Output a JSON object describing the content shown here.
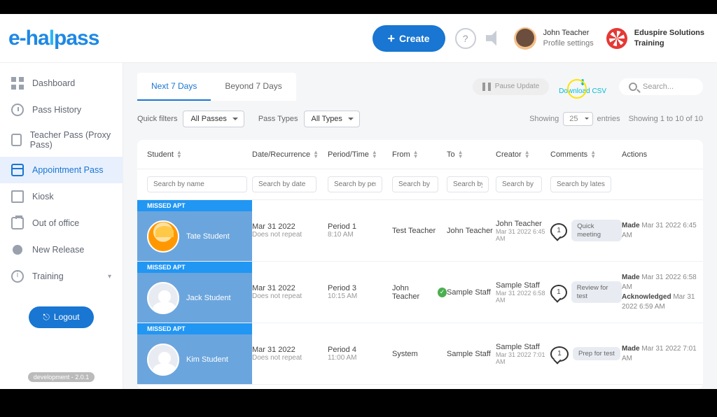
{
  "brand": {
    "name": "e-hallpass"
  },
  "topbar": {
    "create": "Create",
    "user_name": "John Teacher",
    "user_sub": "Profile settings",
    "org1": "Eduspire Solutions",
    "org2": "Training"
  },
  "sidebar": {
    "items": [
      {
        "label": "Dashboard"
      },
      {
        "label": "Pass History"
      },
      {
        "label": "Teacher Pass (Proxy Pass)"
      },
      {
        "label": "Appointment Pass"
      },
      {
        "label": "Kiosk"
      },
      {
        "label": "Out of office"
      },
      {
        "label": "New Release"
      },
      {
        "label": "Training"
      }
    ],
    "logout": "Logout",
    "dev": "development - 2.0.1"
  },
  "tabs": {
    "next": "Next 7 Days",
    "beyond": "Beyond 7 Days"
  },
  "toolbar": {
    "pause": "Pause Update",
    "download": "Download CSV",
    "search_ph": "Search..."
  },
  "filters": {
    "quick_lbl": "Quick filters",
    "quick_val": "All Passes",
    "type_lbl": "Pass Types",
    "type_val": "All Types",
    "showing": "Showing",
    "page_size": "25",
    "entries": "entries",
    "range": "Showing 1 to 10 of 10"
  },
  "table": {
    "cols": {
      "student": "Student",
      "date": "Date/Recurrence",
      "period": "Period/Time",
      "from": "From",
      "to": "To",
      "creator": "Creator",
      "comments": "Comments",
      "actions": "Actions"
    },
    "filters_ph": {
      "name": "Search by name",
      "date": "Search by date",
      "period": "Search by period",
      "from": "Search by",
      "to": "Search by",
      "creator": "Search by",
      "comments": "Search by latest comment"
    },
    "rows": [
      {
        "badge": "MISSED APT",
        "student": "Tate Student",
        "date": "Mar 31 2022",
        "recur": "Does not repeat",
        "period": "Period 1",
        "time": "8:10 AM",
        "from": "Test Teacher",
        "from_check": false,
        "to": "John Teacher",
        "creator": "John Teacher",
        "creator_dt": "Mar 31 2022 6:45 AM",
        "comm_count": "1",
        "comm_text": "Quick meeting",
        "actions": "<b>Made</b> Mar 31 2022  6:45 AM"
      },
      {
        "badge": "MISSED APT",
        "student": "Jack Student",
        "date": "Mar 31 2022",
        "recur": "Does not repeat",
        "period": "Period 3",
        "time": "10:15 AM",
        "from": "John Teacher",
        "from_check": true,
        "to": "Sample Staff",
        "creator": "Sample Staff",
        "creator_dt": "Mar 31 2022 6:58 AM",
        "comm_count": "1",
        "comm_text": "Review for test",
        "actions": "<b>Made</b> Mar 31 2022  6:58 AM<br><b>Acknowledged</b> Mar 31 2022  6:59 AM"
      },
      {
        "badge": "MISSED APT",
        "student": "Kim Student",
        "date": "Mar 31 2022",
        "recur": "Does not repeat",
        "period": "Period 4",
        "time": "11:00 AM",
        "from": "System",
        "from_check": false,
        "to": "Sample Staff",
        "creator": "Sample Staff",
        "creator_dt": "Mar 31 2022 7:01 AM",
        "comm_count": "1",
        "comm_text": "Prep for test",
        "actions": "<b>Made</b> Mar 31 2022  7:01 AM"
      }
    ]
  }
}
